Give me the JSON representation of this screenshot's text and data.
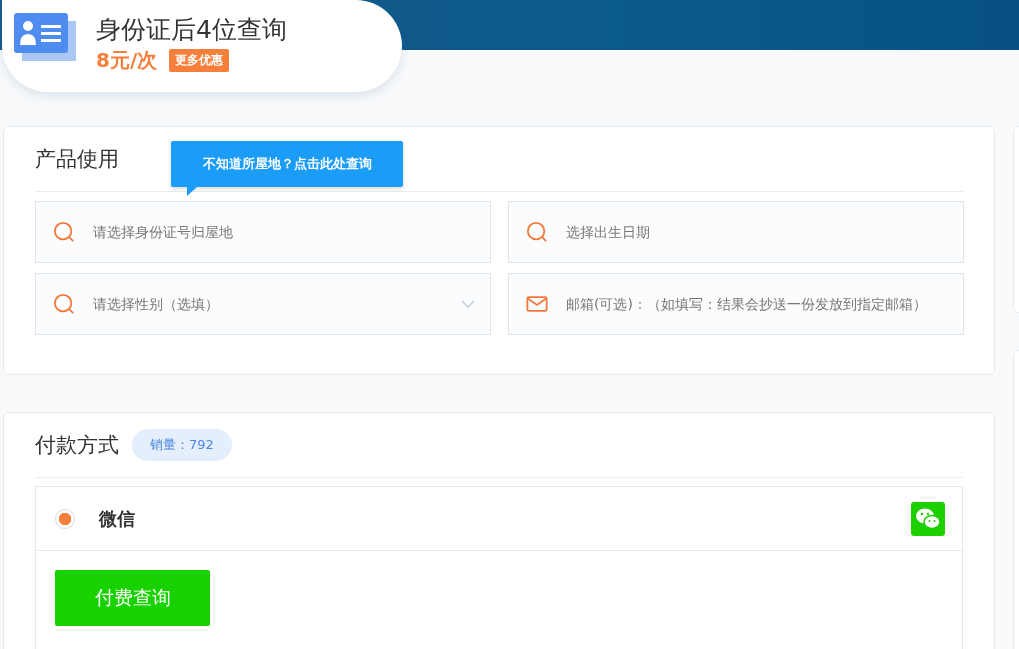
{
  "product": {
    "title": "身份证后4位查询",
    "price": "8元/次",
    "promo_badge": "更多优惠"
  },
  "usage": {
    "title": "产品使用",
    "tooltip": "不知道所屋地？点击此处查询",
    "fields": [
      {
        "kind": "search",
        "placeholder": "请选择身份证号归屋地"
      },
      {
        "kind": "search",
        "placeholder": "选择出生日期"
      },
      {
        "kind": "select",
        "placeholder": "请选择性别（选填）"
      },
      {
        "kind": "mail",
        "placeholder": "邮箱(可选)：（如填写：结果会抄送一份发放到指定邮箱）"
      }
    ]
  },
  "payment": {
    "title": "付款方式",
    "sales": "销量：792",
    "methods": [
      {
        "label": "微信",
        "selected": true
      }
    ],
    "submit": "付费查询"
  }
}
